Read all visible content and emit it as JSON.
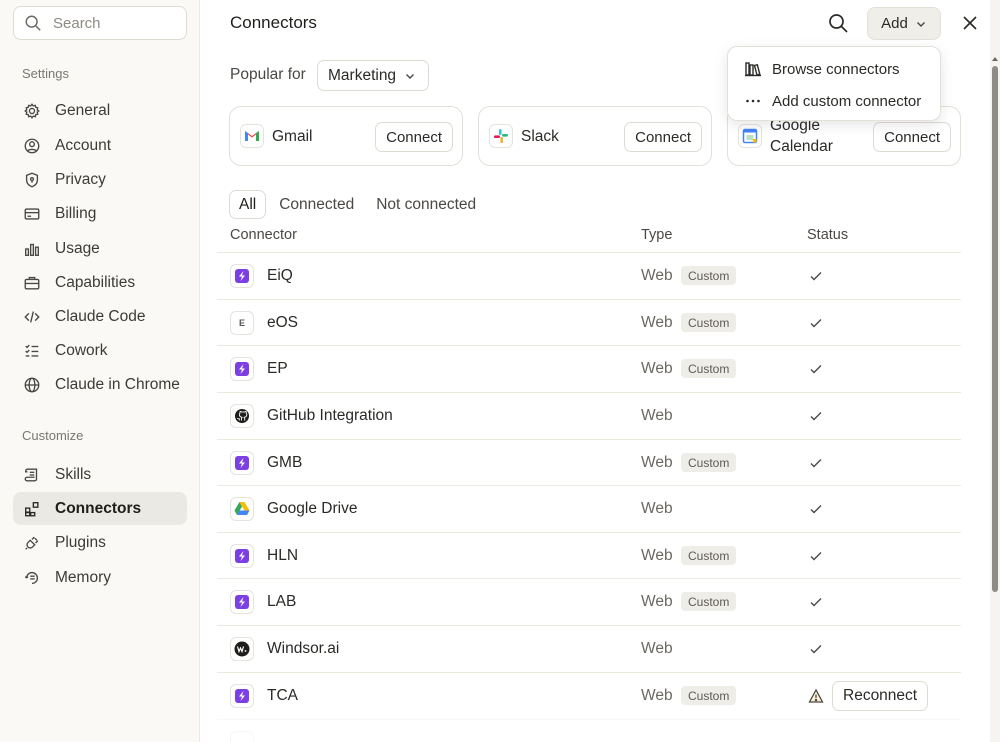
{
  "sidebar": {
    "search_placeholder": "Search",
    "settings_label": "Settings",
    "settings_items": [
      {
        "label": "General",
        "icon": "gear-icon"
      },
      {
        "label": "Account",
        "icon": "user-circle-icon"
      },
      {
        "label": "Privacy",
        "icon": "shield-icon"
      },
      {
        "label": "Billing",
        "icon": "credit-card-icon"
      },
      {
        "label": "Usage",
        "icon": "bar-chart-icon"
      },
      {
        "label": "Capabilities",
        "icon": "briefcase-icon"
      },
      {
        "label": "Claude Code",
        "icon": "code-icon"
      },
      {
        "label": "Cowork",
        "icon": "checklist-icon"
      },
      {
        "label": "Claude in Chrome",
        "icon": "globe-icon"
      }
    ],
    "customize_label": "Customize",
    "customize_items": [
      {
        "label": "Skills",
        "icon": "scroll-icon"
      },
      {
        "label": "Connectors",
        "icon": "blocks-icon",
        "active": true
      },
      {
        "label": "Plugins",
        "icon": "plug-icon"
      },
      {
        "label": "Memory",
        "icon": "memory-icon"
      }
    ]
  },
  "header": {
    "title": "Connectors",
    "add_label": "Add"
  },
  "add_menu": {
    "items": [
      {
        "label": "Browse connectors",
        "icon": "library-icon"
      },
      {
        "label": "Add custom connector",
        "icon": "more-icon"
      }
    ]
  },
  "popular": {
    "label": "Popular for",
    "selected": "Marketing",
    "cards": [
      {
        "name": "Gmail",
        "button": "Connect",
        "icon": "gmail-icon"
      },
      {
        "name": "Slack",
        "button": "Connect",
        "icon": "slack-icon"
      },
      {
        "name": "Google Calendar",
        "button": "Connect",
        "icon": "google-calendar-icon"
      }
    ]
  },
  "filters": [
    "All",
    "Connected",
    "Not connected"
  ],
  "table": {
    "headers": {
      "connector": "Connector",
      "type": "Type",
      "status": "Status"
    },
    "rows": [
      {
        "name": "EiQ",
        "type": "Web",
        "badge": "Custom",
        "status": "connected",
        "logo": "custom-bolt-icon"
      },
      {
        "name": "eOS",
        "type": "Web",
        "badge": "Custom",
        "status": "connected",
        "logo": "letter-e-icon",
        "logo_text": "E"
      },
      {
        "name": "EP",
        "type": "Web",
        "badge": "Custom",
        "status": "connected",
        "logo": "custom-bolt-icon"
      },
      {
        "name": "GitHub Integration",
        "type": "Web",
        "badge": "",
        "status": "connected",
        "logo": "github-icon"
      },
      {
        "name": "GMB",
        "type": "Web",
        "badge": "Custom",
        "status": "connected",
        "logo": "custom-bolt-icon"
      },
      {
        "name": "Google Drive",
        "type": "Web",
        "badge": "",
        "status": "connected",
        "logo": "google-drive-icon"
      },
      {
        "name": "HLN",
        "type": "Web",
        "badge": "Custom",
        "status": "connected",
        "logo": "custom-bolt-icon"
      },
      {
        "name": "LAB",
        "type": "Web",
        "badge": "Custom",
        "status": "connected",
        "logo": "custom-bolt-icon"
      },
      {
        "name": "Windsor.ai",
        "type": "Web",
        "badge": "",
        "status": "connected",
        "logo": "windsor-icon"
      },
      {
        "name": "TCA",
        "type": "Web",
        "badge": "Custom",
        "status": "warning",
        "button": "Reconnect",
        "logo": "custom-bolt-icon"
      }
    ]
  },
  "colors": {
    "sidebar_bg": "#faf9f6",
    "active_nav": "#ebe9e3",
    "custom_logo": "#7b3fe4",
    "badge_bg": "#efede8"
  }
}
